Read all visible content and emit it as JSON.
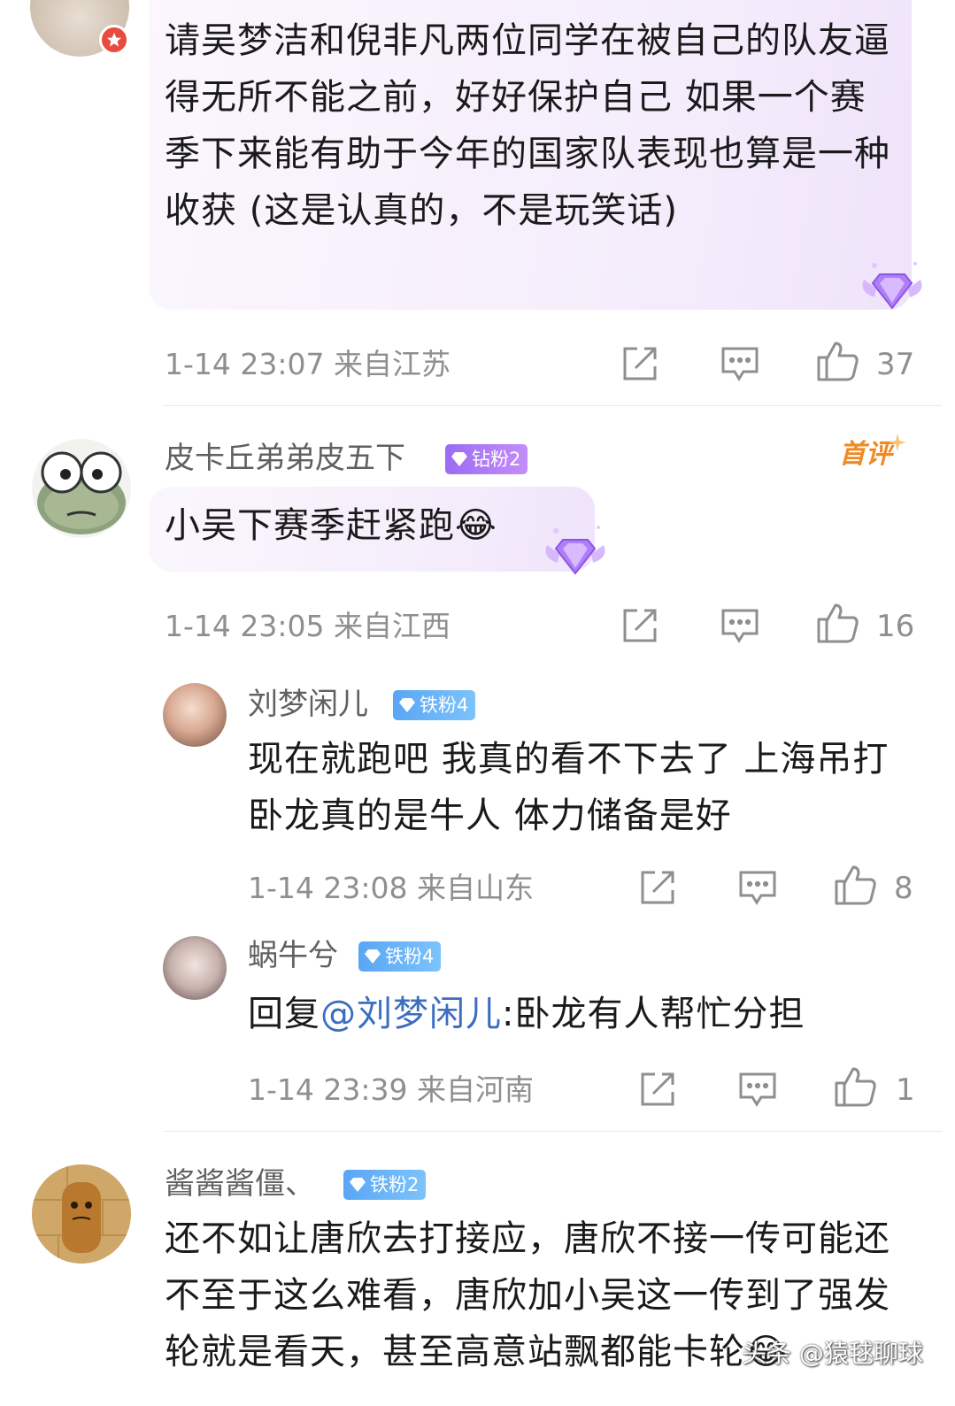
{
  "top_partial": {
    "comment": "请吴梦洁和倪非凡两位同学在被自己的队友逼得无所不能之前，好好保护自己 如果一个赛季下来能有助于今年的国家队表现也算是一种收获 (这是认真的，不是玩笑话)",
    "meta": "1-14 23:07  来自江苏",
    "likes": "37"
  },
  "comments": [
    {
      "username": "皮卡丘弟弟皮五下",
      "badge": "钻粉2",
      "tag": "首评",
      "text": "小吴下赛季赶紧跑😂",
      "meta": "1-14 23:05  来自江西",
      "likes": "16",
      "replies": [
        {
          "username": "刘梦闲儿",
          "badge": "铁粉4",
          "text": "现在就跑吧 我真的看不下去了 上海吊打 卧龙真的是牛人 体力储备是好",
          "meta": "1-14 23:08  来自山东",
          "likes": "8"
        },
        {
          "username": "蜗牛兮",
          "badge": "铁粉4",
          "reply_prefix": "回复",
          "mention": "@刘梦闲儿",
          "text_after": ":卧龙有人帮忙分担",
          "meta": "1-14 23:39  来自河南",
          "likes": "1"
        }
      ]
    },
    {
      "username": "酱酱酱僵、",
      "badge": "铁粉2",
      "text": "还不如让唐欣去打接应，唐欣不接一传可能还不至于这么难看，唐欣加小吴这一传到了强发轮就是看天，甚至高意站飘都能卡轮😂"
    }
  ],
  "watermark": "头条 @猿毬聊球",
  "colors": {
    "accent_purple": "#a97af5",
    "accent_blue": "#69b2f8",
    "first_comment_orange": "#f08a24",
    "mention_blue": "#3b6dc1"
  }
}
